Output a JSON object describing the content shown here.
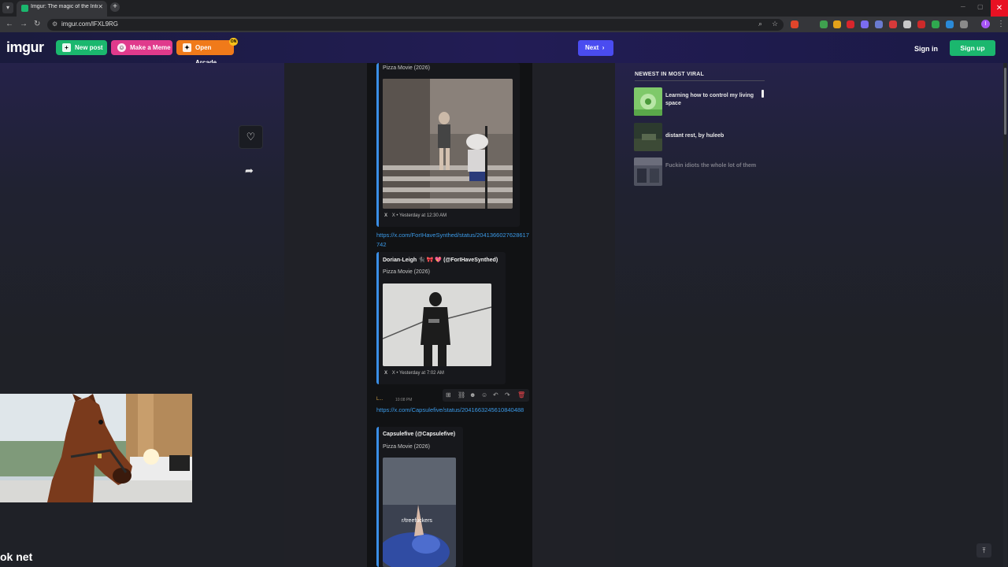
{
  "browser": {
    "tab_title": "Imgur: The magic of the Interne",
    "tab_close": "✕",
    "new_tab": "+",
    "url": "imgur.com/lFXL9RG",
    "profile_initial": "I"
  },
  "header": {
    "logo": "imgur",
    "new_post": "New post",
    "make_meme": "Make a Meme",
    "open_arcade": "Open Arcade",
    "arcade_badge": "ON",
    "next": "Next",
    "sign_in": "Sign in",
    "sign_up": "Sign up"
  },
  "post": {
    "embeds": [
      {
        "title": "Pizza Movie (2026)",
        "footer": "X • Yesterday at 12:30 AM"
      },
      {
        "link": "https://x.com/ForIHaveSynthed/status/2041366027628617742",
        "author": "Dorian-Leigh 🐈‍⬛ 🎀 💖 (@ForIHaveSynthed)",
        "title": "Pizza Movie (2026)",
        "footer": "X • Yesterday at 7:02 AM"
      },
      {
        "message_user": "L...",
        "message_time": "10:08 PM",
        "link": "https://x.com/Capsulefive/status/2041663245610840488",
        "author": "Capsulefive (@Capsulefive)",
        "title": "Pizza Movie (2026)",
        "media_caption": "r/treefuckers"
      }
    ]
  },
  "sidebar": {
    "title": "NEWEST IN MOST VIRAL",
    "items": [
      {
        "title": "Learning how to control my living space"
      },
      {
        "title": "distant rest, by huleeb"
      },
      {
        "title": "Fuckin idiots the whole lot of them"
      }
    ]
  },
  "overlay": {
    "text": "ok net"
  },
  "colors": {
    "accent_green": "#1bb76e",
    "accent_pink": "#e03a8c",
    "accent_orange": "#f07a1a",
    "accent_blue": "#4a4cf0",
    "link_blue": "#3b9ae8"
  }
}
